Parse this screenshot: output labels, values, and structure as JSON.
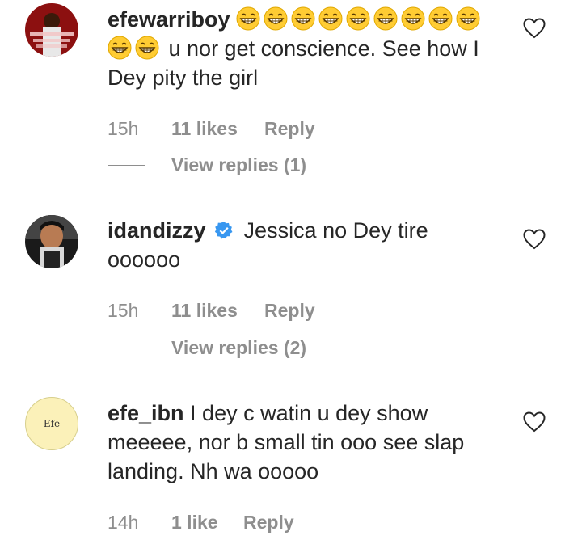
{
  "comments": [
    {
      "username": "efewarriboy",
      "emoji_count": 11,
      "emoji": "grinning-squinting-face",
      "text": "u nor get conscience. See how I Dey pity the girl",
      "time": "15h",
      "likes": "11 likes",
      "reply": "Reply",
      "view_replies": "View replies (1)"
    },
    {
      "username": "idandizzy",
      "verified": true,
      "text": "Jessica no Dey tire oooooo",
      "time": "15h",
      "likes": "11 likes",
      "reply": "Reply",
      "view_replies": "View replies (2)"
    },
    {
      "username": "efe_ibn",
      "avatar_text": "Efe",
      "text": "I dey c watin u dey show meeeee, nor b small tin ooo see slap landing. Nh wa ooooo",
      "time": "14h",
      "likes": "1 like",
      "reply": "Reply"
    }
  ],
  "colors": {
    "text": "#262626",
    "meta": "#8e8e8e",
    "verified": "#3897f0"
  }
}
